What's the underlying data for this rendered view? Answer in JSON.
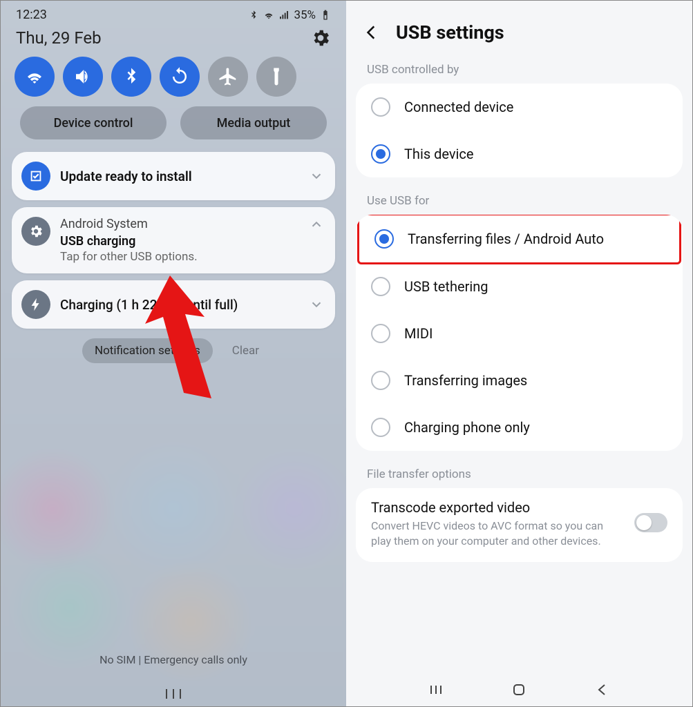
{
  "left": {
    "status": {
      "time": "12:23",
      "battery": "35%"
    },
    "date": "Thu, 29 Feb",
    "pills": {
      "device_control": "Device control",
      "media_output": "Media output"
    },
    "cards": {
      "update": {
        "title": "Update ready to install"
      },
      "system": {
        "app": "Android System",
        "title": "USB charging",
        "sub": "Tap for other USB options."
      },
      "charging": {
        "title": "Charging (1 h 22 min until full)"
      }
    },
    "under": {
      "settings": "Notification settings",
      "clear": "Clear"
    },
    "bottom": "No SIM | Emergency calls only"
  },
  "right": {
    "title": "USB settings",
    "section1": "USB controlled by",
    "controlled": {
      "connected": "Connected device",
      "this": "This device"
    },
    "section2": "Use USB for",
    "usefor": {
      "transfer": "Transferring files / Android Auto",
      "tether": "USB tethering",
      "midi": "MIDI",
      "images": "Transferring images",
      "charge": "Charging phone only"
    },
    "section3": "File transfer options",
    "transcode": {
      "title": "Transcode exported video",
      "sub": "Convert HEVC videos to AVC format so you can play them on your computer and other devices."
    }
  }
}
